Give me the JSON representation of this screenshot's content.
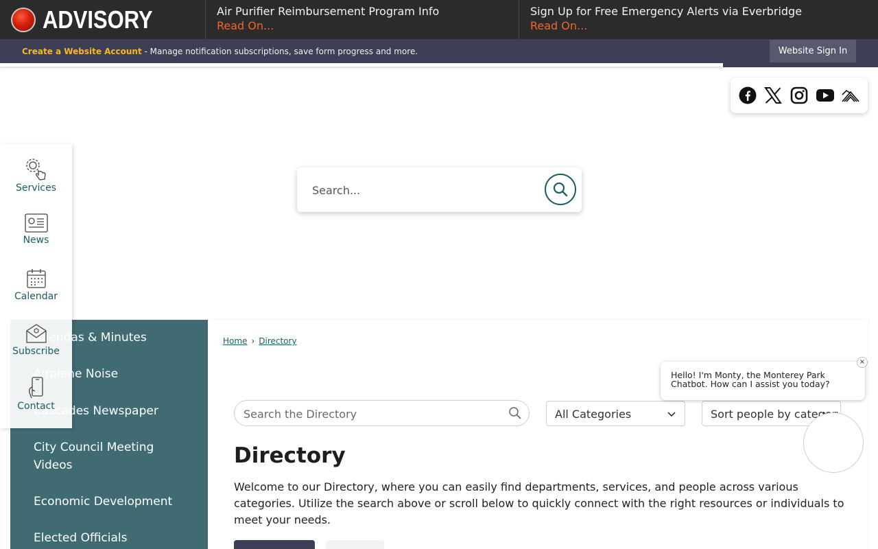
{
  "advisory": {
    "label": "ADVISORY",
    "items": [
      {
        "title": "Air Purifier Reimbursement Program Info",
        "read_more": "Read On..."
      },
      {
        "title": "Sign Up for Free Emergency Alerts via Everbridge",
        "read_more": "Read On..."
      }
    ]
  },
  "account_bar": {
    "link": "Create a Website Account",
    "text": " - Manage notification subscriptions, save form progress and more.",
    "signin": "Website Sign In"
  },
  "social": [
    "facebook-icon",
    "x-icon",
    "instagram-icon",
    "youtube-icon",
    "nextdoor-icon"
  ],
  "search": {
    "placeholder": "Search..."
  },
  "quick_links": [
    {
      "label": "Services",
      "icon": "gear-hand-icon"
    },
    {
      "label": "News",
      "icon": "newspaper-icon"
    },
    {
      "label": "Calendar",
      "icon": "calendar-icon"
    },
    {
      "label": "Subscribe",
      "icon": "envelope-icon"
    },
    {
      "label": "Contact",
      "icon": "phone-icon"
    }
  ],
  "left_nav": {
    "items": [
      "Agendas & Minutes",
      "Airplane Noise",
      "Cascades Newspaper",
      "City Council Meeting Videos",
      "Economic Development",
      "Elected Officials"
    ]
  },
  "breadcrumb": {
    "home": "Home",
    "separator": "›",
    "current": "Directory"
  },
  "directory": {
    "search_placeholder": "Search the Directory",
    "category_select": "All Categories",
    "sort_select": "Sort people by category",
    "title": "Directory",
    "description": "Welcome to our Directory, where you can easily find departments, services, and people across various categories. Utilize the search above or scroll below to quickly connect with the right resources or individuals to meet your needs."
  },
  "chatbot": {
    "message": "Hello! I'm Monty, the Monterey Park Chatbot. How can I assist you today?",
    "close": "×"
  },
  "colors": {
    "advisory_bg": "#2b2b2b",
    "account_bar_bg": "#3c3f55",
    "link_accent": "#f6b823",
    "read_more": "#f0662b",
    "nav_teal": "#416b73",
    "brand_teal": "#1a5e62"
  }
}
